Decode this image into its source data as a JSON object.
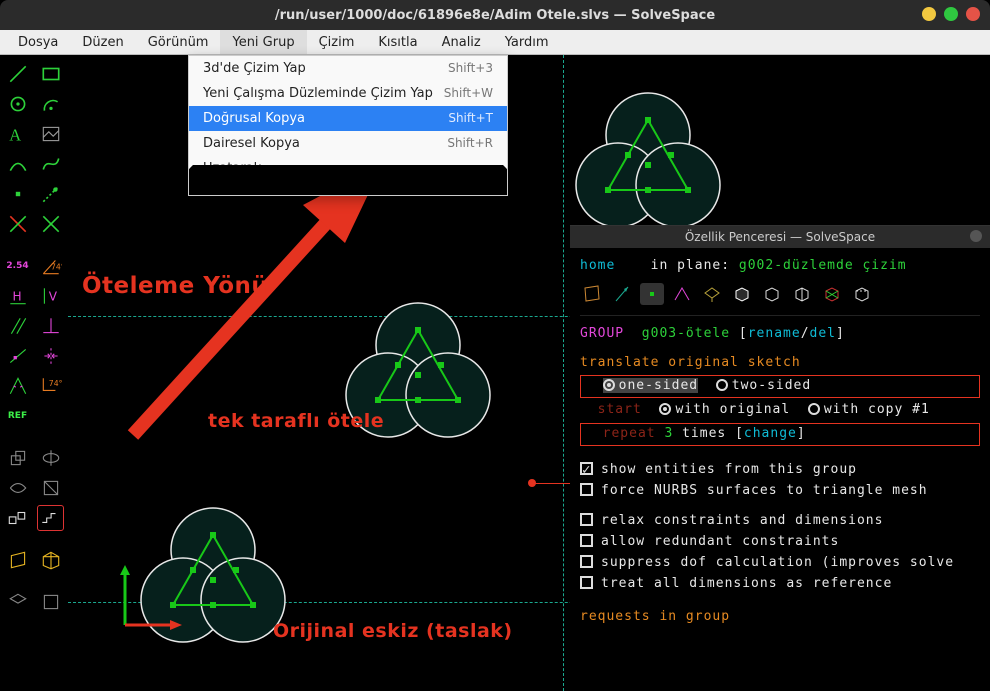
{
  "window": {
    "title": "/run/user/1000/doc/61896e8e/Adim Otele.slvs — SolveSpace"
  },
  "menubar": {
    "items": [
      "Dosya",
      "Düzen",
      "Görünüm",
      "Yeni Grup",
      "Çizim",
      "Kısıtla",
      "Analiz",
      "Yardım"
    ],
    "active_index": 3
  },
  "dropdown": {
    "items": [
      {
        "label": "3d'de Çizim Yap",
        "shortcut": "Shift+3"
      },
      {
        "label": "Yeni Çalışma Düzleminde Çizim Yap",
        "shortcut": "Shift+W"
      },
      {
        "label": "Doğrusal Kopya",
        "shortcut": "Shift+T",
        "highlighted": true
      },
      {
        "label": "Dairesel Kopya",
        "shortcut": "Shift+R"
      },
      {
        "label": "Uzatarak ...",
        "shortcut": ""
      }
    ]
  },
  "annotations": {
    "direction": "Öteleme Yönü",
    "one_sided": "tek taraflı ötele",
    "original": "Orijinal eskiz (taslak)"
  },
  "panel": {
    "title": "Özellik Penceresi — SolveSpace",
    "home": "home",
    "in_plane_label": "in plane:",
    "in_plane_value": "g002-düzlemde çizim",
    "group_label": "GROUP",
    "group_value": "g003-ötele",
    "rename": "rename",
    "del": "del",
    "translate": "translate original sketch",
    "one_sided": "one-sided",
    "two_sided": "two-sided",
    "start": "start",
    "with_original": "with original",
    "with_copy": "with copy #1",
    "repeat": "repeat",
    "repeat_count": "3",
    "times": "times",
    "change": "change",
    "opts": {
      "show_entities": "show entities from this group",
      "force_nurbs": "force NURBS surfaces to triangle mesh",
      "relax": "relax constraints and dimensions",
      "redundant": "allow redundant constraints",
      "suppress_dof": "suppress dof calculation (improves solve",
      "treat_ref": "treat all dimensions as reference"
    },
    "requests": "requests in group"
  },
  "toolbar": {
    "icons": [
      "line",
      "rect",
      "circle",
      "arc",
      "text",
      "image",
      "tangent",
      "bezier",
      "point",
      "construction",
      "trim",
      "split",
      "dim",
      "angle",
      "horiz",
      "vert",
      "perp",
      "parallel",
      "sym",
      "midpoint",
      "equal",
      "coincident",
      "ref",
      "extrude",
      "revolve",
      "lathe",
      "boolean",
      "assembly",
      "step",
      "nearest",
      "isometric",
      "zoom"
    ]
  }
}
